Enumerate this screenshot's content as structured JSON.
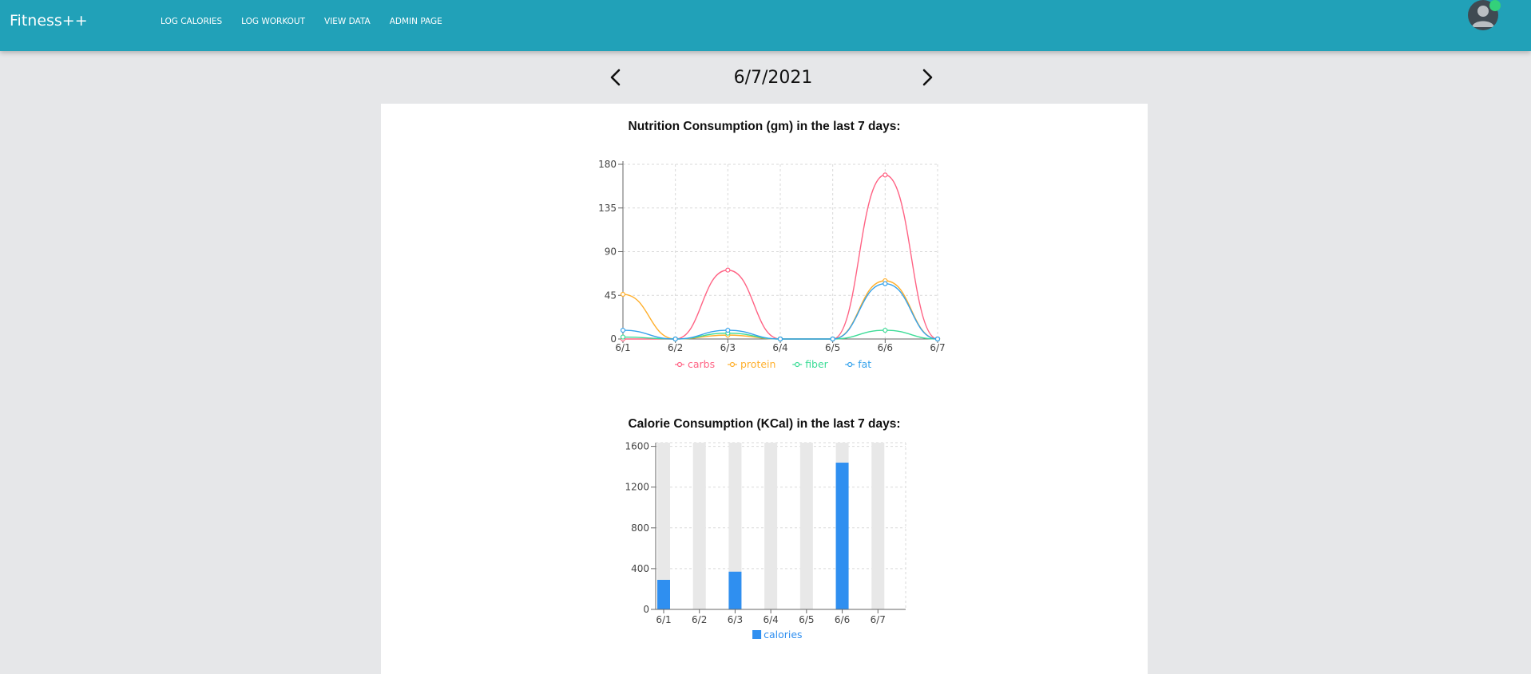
{
  "header": {
    "brand": "Fitness++",
    "nav": [
      "LOG CALORIES",
      "LOG WORKOUT",
      "VIEW DATA",
      "ADMIN PAGE"
    ]
  },
  "date_nav": {
    "date": "6/7/2021"
  },
  "colors": {
    "header_bg": "#21a1b8",
    "carbs": "#ff6384",
    "protein": "#ffb02e",
    "fiber": "#3ddc97",
    "fat": "#36a2eb",
    "calories": "#2f8ff0"
  },
  "chart_data": [
    {
      "type": "line",
      "title": "Nutrition Consumption (gm) in the last 7 days:",
      "x": [
        "6/1",
        "6/2",
        "6/3",
        "6/4",
        "6/5",
        "6/6",
        "6/7"
      ],
      "y_ticks": [
        "180",
        "135",
        "90",
        "45",
        "0"
      ],
      "ylim": [
        0,
        180
      ],
      "grid": true,
      "legend_position": "bottom",
      "series": [
        {
          "name": "carbs",
          "values": [
            0,
            0,
            71,
            0,
            0,
            169,
            0
          ]
        },
        {
          "name": "protein",
          "values": [
            46,
            0,
            4,
            0,
            0,
            60,
            0
          ]
        },
        {
          "name": "fiber",
          "values": [
            2,
            0,
            6,
            0,
            0,
            9,
            0
          ]
        },
        {
          "name": "fat",
          "values": [
            9,
            0,
            9,
            0,
            0,
            57,
            0
          ]
        }
      ]
    },
    {
      "type": "bar",
      "title": "Calorie Consumption (KCal) in the last 7 days:",
      "categories": [
        "6/1",
        "6/2",
        "6/3",
        "6/4",
        "6/5",
        "6/6",
        "6/7"
      ],
      "y_ticks": [
        "1600",
        "1200",
        "800",
        "400",
        "0"
      ],
      "ylim": [
        0,
        1600
      ],
      "grid": true,
      "legend_position": "bottom",
      "series": [
        {
          "name": "calories",
          "values": [
            290,
            0,
            370,
            0,
            0,
            1440,
            0
          ]
        }
      ]
    }
  ]
}
